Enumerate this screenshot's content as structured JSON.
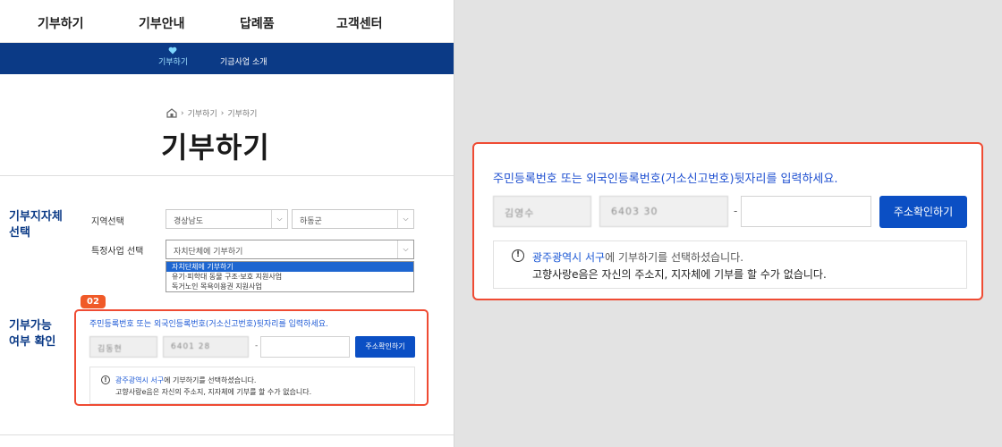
{
  "nav": {
    "menu": [
      "기부하기",
      "기부안내",
      "답례품",
      "고객센터"
    ],
    "submenu": [
      "기부하기",
      "기금사업 소개"
    ]
  },
  "breadcrumb": [
    "기부하기",
    "기부하기"
  ],
  "page_title": "기부하기",
  "region": {
    "section_title": "기부지자체 선택",
    "region_label": "지역선택",
    "province_value": "경상남도",
    "city_value": "하동군",
    "project_label": "특정사업 선택",
    "project_value": "자치단체에 기부하기",
    "options": [
      "자치단체에 기부하기",
      "유기·피학대 동물 구조·보호 지원사업",
      "독거노인 목욕이용권 지원사업"
    ]
  },
  "verify": {
    "step_badge": "02",
    "section_title": "기부가능 여부 확인",
    "description": "주민등록번호 또는 외국인등록번호(거소신고번호)뒷자리를 입력하세요.",
    "name_masked": "김동현",
    "birth_masked": "6401 28",
    "dash": "-",
    "check_button": "주소확인하기",
    "notice_highlight": "광주광역시 서구",
    "notice_line1_rest": "에 기부하기를 선택하셨습니다.",
    "notice_line2": "고향사랑e음은 자신의 주소지, 지자체에 기부를 할 수가 없습니다."
  },
  "zoom": {
    "description": "주민등록번호 또는 외국인등록번호(거소신고번호)뒷자리를 입력하세요.",
    "name_masked": "김영수",
    "birth_masked": "6403 30",
    "dash": "-",
    "check_button": "주소확인하기",
    "notice_highlight": "광주광역시 서구",
    "notice_line1_rest": "에 기부하기를 선택하셨습니다.",
    "notice_line2": "고향사랑e음은 자신의 주소지, 지자체에 기부를 할 수가 없습니다."
  }
}
